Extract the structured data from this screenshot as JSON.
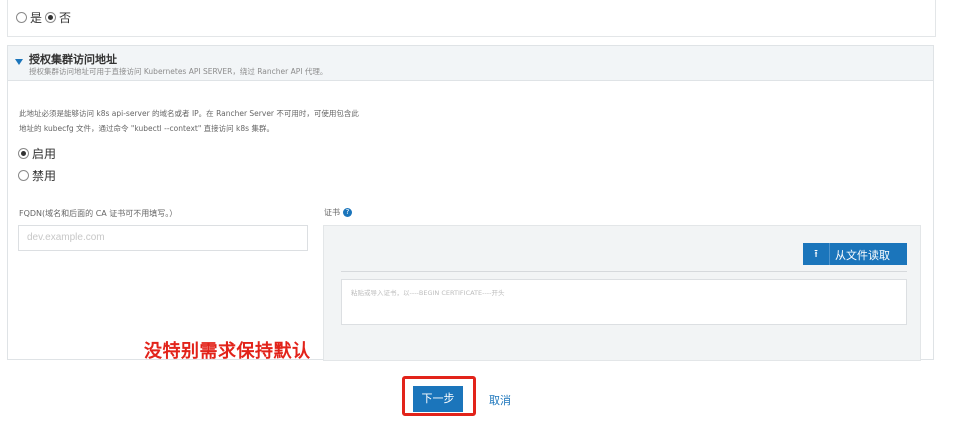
{
  "top_panel": {
    "options": [
      {
        "label": "是",
        "checked": false
      },
      {
        "label": "否",
        "checked": true
      }
    ]
  },
  "section": {
    "title": "授权集群访问地址",
    "subtitle": "授权集群访问地址可用于直接访问 Kubernetes API SERVER，绕过 Rancher API 代理。",
    "description_line1": "此地址必须是能够访问 k8s api-server 的域名或者 IP。在 Rancher Server 不可用时，可使用包含此",
    "description_line2": "地址的 kubecfg 文件，通过命令 \"kubectl --context\" 直接访问 k8s 集群。",
    "options": [
      {
        "label": "启用",
        "checked": true
      },
      {
        "label": "禁用",
        "checked": false
      }
    ],
    "fqdn_label": "FQDN(域名和后面的 CA 证书可不用填写。）",
    "fqdn_placeholder": "dev.example.com",
    "cert_label": "证书",
    "help_icon": "?",
    "read_file_label": "从文件读取",
    "upload_icon": "upload-icon",
    "cert_placeholder": "粘贴或导入证书，以----BEGIN CERTIFICATE----开头"
  },
  "annotation": "没特别需求保持默认",
  "footer": {
    "next_label": "下一步",
    "cancel_label": "取消"
  },
  "colors": {
    "primary": "#1b75bb",
    "annotation_red": "#e2231a",
    "header_bg": "#f2f5f7"
  }
}
